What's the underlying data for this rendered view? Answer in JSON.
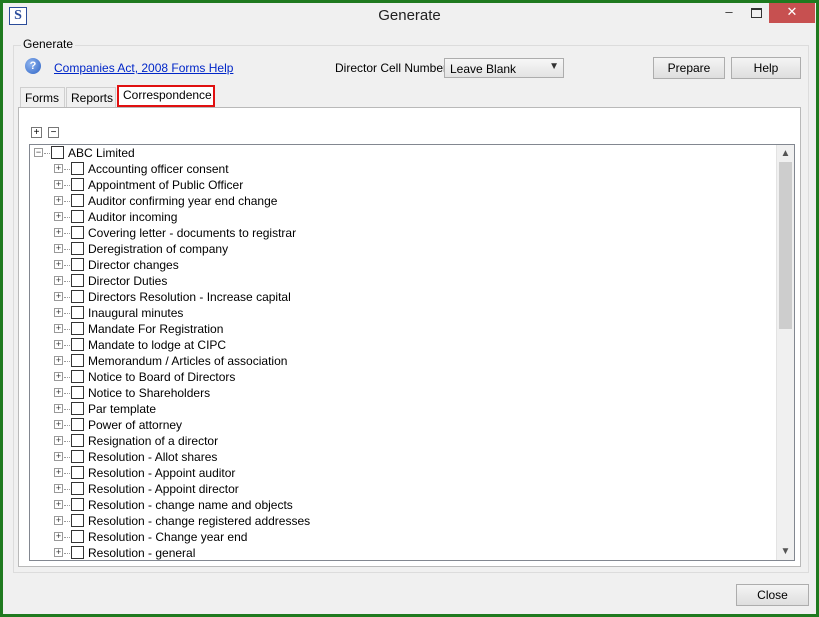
{
  "window": {
    "title": "Generate",
    "icon_letter": "S"
  },
  "controls": {
    "minimize": "–",
    "close": "✕"
  },
  "group": {
    "label": "Generate"
  },
  "help_link": {
    "text": "Companies Act, 2008 Forms Help",
    "icon": "?"
  },
  "director_cell": {
    "label": "Director Cell Number:",
    "value": "Leave Blank"
  },
  "buttons": {
    "prepare": "Prepare",
    "help": "Help",
    "close": "Close"
  },
  "tabs": [
    {
      "label": "Forms",
      "selected": false
    },
    {
      "label": "Reports",
      "selected": false
    },
    {
      "label": "Correspondence",
      "selected": true
    }
  ],
  "tree": {
    "expand_all": "+",
    "collapse_all": "−",
    "root": "ABC Limited",
    "items": [
      "Accounting officer consent",
      "Appointment of Public Officer",
      "Auditor confirming year end change",
      "Auditor incoming",
      "Covering letter - documents to registrar",
      "Deregistration of company",
      "Director changes",
      "Director Duties",
      "Directors Resolution - Increase capital",
      "Inaugural minutes",
      "Mandate For Registration",
      "Mandate to lodge at CIPC",
      "Memorandum / Articles of association",
      "Notice to Board of Directors",
      "Notice to Shareholders",
      "Par template",
      "Power of attorney",
      "Resignation of a director",
      "Resolution - Allot shares",
      "Resolution - Appoint auditor",
      "Resolution - Appoint director",
      "Resolution - change name and objects",
      "Resolution - change registered addresses",
      "Resolution - Change year end",
      "Resolution - general"
    ]
  },
  "colors": {
    "highlight_border": "#e01010",
    "link": "#0026c8",
    "window_frame": "#1f7a1f"
  }
}
